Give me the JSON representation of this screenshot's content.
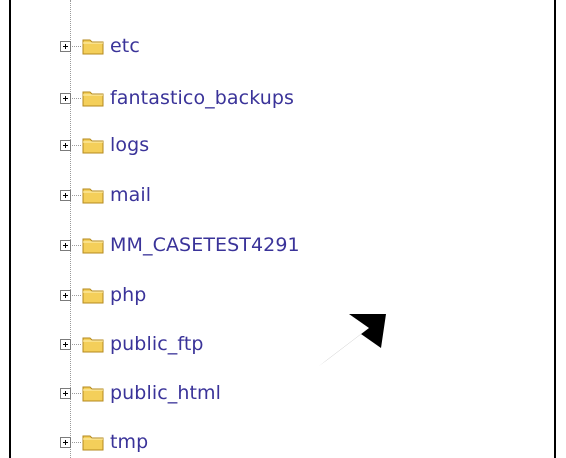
{
  "tree": {
    "items": [
      {
        "label": "etc"
      },
      {
        "label": "fantastico_backups"
      },
      {
        "label": "logs"
      },
      {
        "label": "mail"
      },
      {
        "label": "MM_CASETEST4291"
      },
      {
        "label": "php"
      },
      {
        "label": "public_ftp"
      },
      {
        "label": "public_html"
      },
      {
        "label": "tmp"
      }
    ]
  },
  "colors": {
    "label": "#3a3399",
    "folder": "#f4cf5a",
    "arrow": "#000000"
  },
  "icons": {
    "expander": "plus-box-icon",
    "folder": "folder-icon",
    "pointer": "arrow-icon"
  }
}
